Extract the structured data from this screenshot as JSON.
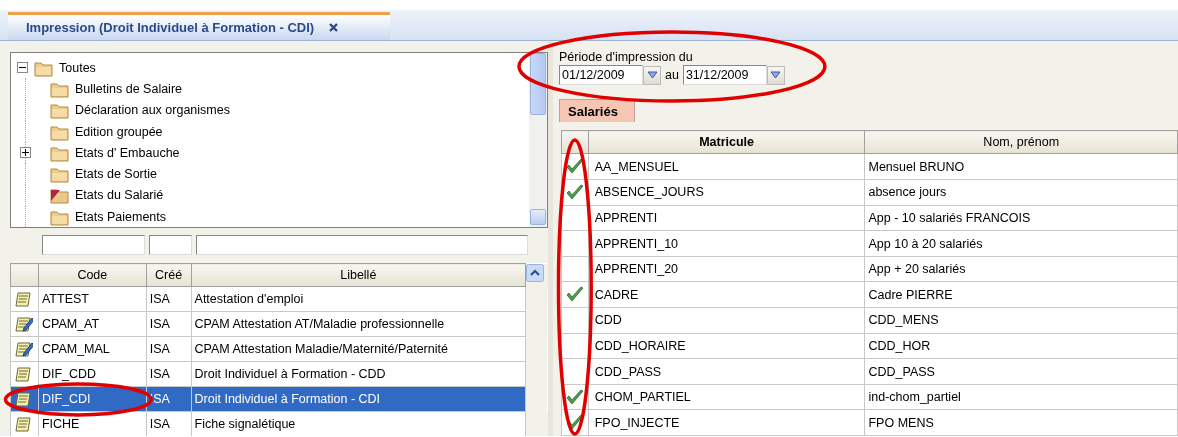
{
  "tab": {
    "title": "Impression (Droit Individuel à Formation - CDI)",
    "selected": true
  },
  "tree": {
    "label": "Toutes",
    "expanded": true,
    "children": [
      {
        "label": "Bulletins de Salaire",
        "kind": "folder"
      },
      {
        "label": "Déclaration aux organismes",
        "kind": "folder"
      },
      {
        "label": "Edition groupée",
        "kind": "folder"
      },
      {
        "label": "Etats d' Embauche",
        "kind": "folder",
        "expanded": false
      },
      {
        "label": "Etats de Sortie",
        "kind": "folder"
      },
      {
        "label": "Etats du Salarié",
        "kind": "marked-folder"
      },
      {
        "label": "Etats Paiements",
        "kind": "folder"
      }
    ]
  },
  "reports": {
    "columns": [
      "Code",
      "Créé",
      "Libellé"
    ],
    "rows": [
      {
        "kind": "document",
        "code": "ATTEST",
        "created": "ISA",
        "label": "Attestation d'emploi",
        "selected": false,
        "circled": false
      },
      {
        "kind": "edit-document",
        "code": "CPAM_AT",
        "created": "ISA",
        "label": "CPAM Attestation AT/Maladie professionnelle",
        "selected": false,
        "circled": false
      },
      {
        "kind": "edit-document",
        "code": "CPAM_MAL",
        "created": "ISA",
        "label": "CPAM Attestation Maladie/Maternité/Paternité",
        "selected": false,
        "circled": false
      },
      {
        "kind": "document",
        "code": "DIF_CDD",
        "created": "ISA",
        "label": "Droit Individuel à Formation - CDD",
        "selected": false,
        "circled": false
      },
      {
        "kind": "document",
        "code": "DIF_CDI",
        "created": "ISA",
        "label": "Droit Individuel à Formation - CDI",
        "selected": true,
        "circled": true
      },
      {
        "kind": "document",
        "code": "FICHE",
        "created": "ISA",
        "label": "Fiche signalétique",
        "selected": false,
        "circled": false
      }
    ]
  },
  "period": {
    "label": "Période d'impression du",
    "from": "01/12/2009",
    "separator": "au",
    "to": "31/12/2009",
    "circled": true
  },
  "employees_tab": {
    "label": "Salariés",
    "selected": true
  },
  "employees": {
    "columns": [
      "Matricule",
      "Nom, prénom"
    ],
    "check_column_circled": true,
    "rows": [
      {
        "checked": true,
        "id": "AA_MENSUEL",
        "name": "Mensuel BRUNO"
      },
      {
        "checked": true,
        "id": "ABSENCE_JOURS",
        "name": "absence jours"
      },
      {
        "checked": false,
        "id": "APPRENTI",
        "name": "App - 10 salariés FRANCOIS"
      },
      {
        "checked": false,
        "id": "APPRENTI_10",
        "name": "App 10 à 20 salariés"
      },
      {
        "checked": false,
        "id": "APPRENTI_20",
        "name": "App + 20 salariés"
      },
      {
        "checked": true,
        "id": "CADRE",
        "name": "Cadre PIERRE"
      },
      {
        "checked": false,
        "id": "CDD",
        "name": "CDD_MENS"
      },
      {
        "checked": false,
        "id": "CDD_HORAIRE",
        "name": "CDD_HOR"
      },
      {
        "checked": false,
        "id": "CDD_PASS",
        "name": "CDD_PASS"
      },
      {
        "checked": true,
        "id": "CHOM_PARTIEL",
        "name": "ind-chom_partiel"
      },
      {
        "checked": true,
        "id": "FPO_INJECTE",
        "name": "FPO MENS"
      }
    ]
  }
}
